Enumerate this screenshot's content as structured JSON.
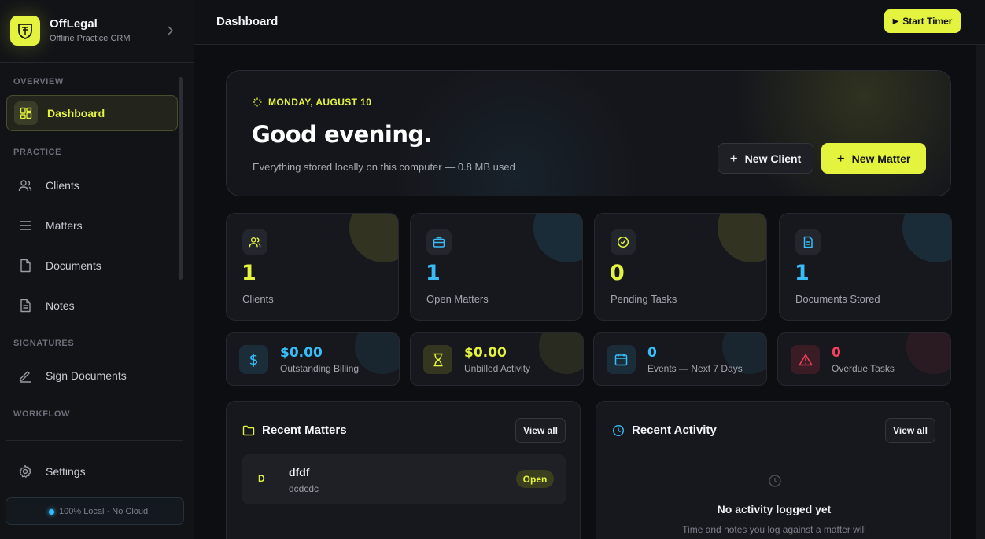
{
  "app": {
    "name": "OffLegal",
    "tagline": "Offline Practice CRM",
    "accent": "#e4f43e"
  },
  "sidebar": {
    "sections": {
      "overview": "OVERVIEW",
      "practice": "PRACTICE",
      "signatures": "SIGNATURES",
      "workflow": "WORKFLOW"
    },
    "items": [
      {
        "label": "Dashboard",
        "icon": "dashboard-icon",
        "active": true
      },
      {
        "label": "Clients",
        "icon": "users-icon"
      },
      {
        "label": "Matters",
        "icon": "list-icon"
      },
      {
        "label": "Documents",
        "icon": "file-icon"
      },
      {
        "label": "Notes",
        "icon": "notes-icon"
      },
      {
        "label": "Sign Documents",
        "icon": "pen-icon"
      }
    ],
    "settings_label": "Settings",
    "storage_status": "100% Local · No Cloud"
  },
  "header": {
    "title": "Dashboard",
    "timer_label": "Start Timer"
  },
  "hero": {
    "date": "MONDAY, AUGUST 10",
    "greeting": "Good evening.",
    "subtitle": "Everything stored locally on this computer — 0.8 MB used",
    "new_client_label": "New Client",
    "new_matter_label": "New Matter"
  },
  "stats": [
    {
      "value": "1",
      "label": "Clients",
      "color": "#e4f43e"
    },
    {
      "value": "1",
      "label": "Open Matters",
      "color": "#38bdf8"
    },
    {
      "value": "0",
      "label": "Pending Tasks",
      "color": "#e4f43e"
    },
    {
      "value": "1",
      "label": "Documents Stored",
      "color": "#38bdf8"
    }
  ],
  "metrics": [
    {
      "value": "$0.00",
      "label": "Outstanding Billing",
      "color": "#38bdf8"
    },
    {
      "value": "$0.00",
      "label": "Unbilled Activity",
      "color": "#e4f43e"
    },
    {
      "value": "0",
      "label": "Events — Next 7 Days",
      "color": "#38bdf8"
    },
    {
      "value": "0",
      "label": "Overdue Tasks",
      "color": "#f43f5e"
    }
  ],
  "recent_matters": {
    "title": "Recent Matters",
    "view_all": "View all",
    "items": [
      {
        "initial": "D",
        "name": "dfdf",
        "client": "dcdcdc",
        "status": "Open"
      }
    ]
  },
  "recent_activity": {
    "title": "Recent Activity",
    "view_all": "View all",
    "empty_title": "No activity logged yet",
    "empty_subtitle": "Time and notes you log against a matter will"
  }
}
